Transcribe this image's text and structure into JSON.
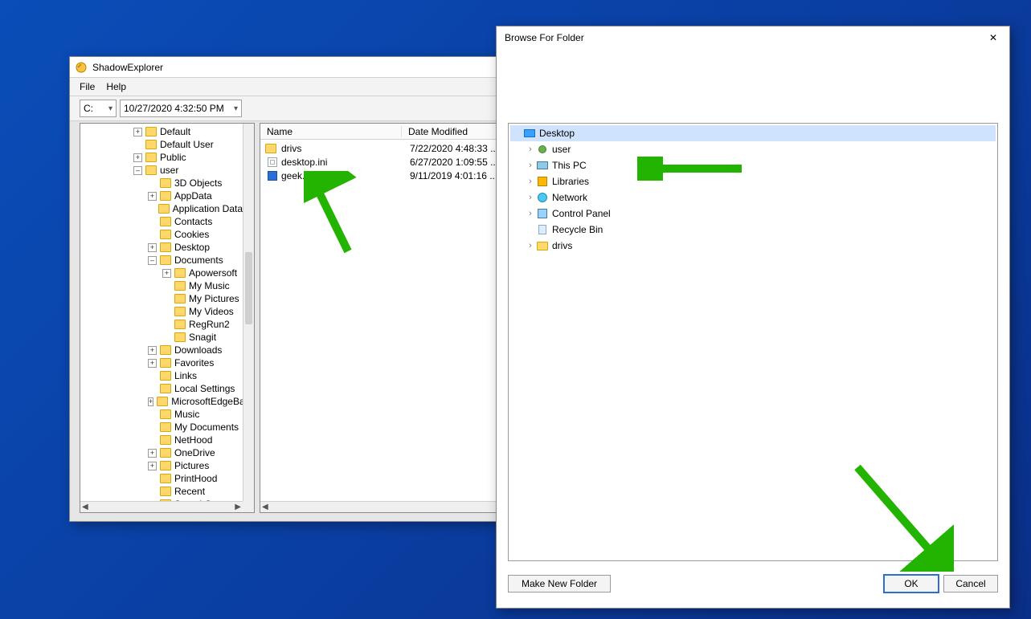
{
  "shadow": {
    "title": "ShadowExplorer",
    "menu": {
      "file": "File",
      "help": "Help"
    },
    "drive": "C:",
    "snapshot": "10/27/2020 4:32:50 PM",
    "tree": [
      {
        "level": 2,
        "exp": "+",
        "label": "Default"
      },
      {
        "level": 2,
        "exp": "",
        "label": "Default User"
      },
      {
        "level": 2,
        "exp": "+",
        "label": "Public"
      },
      {
        "level": 2,
        "exp": "-",
        "label": "user"
      },
      {
        "level": 3,
        "exp": "",
        "label": "3D Objects"
      },
      {
        "level": 3,
        "exp": "+",
        "label": "AppData"
      },
      {
        "level": 3,
        "exp": "",
        "label": "Application Data"
      },
      {
        "level": 3,
        "exp": "",
        "label": "Contacts"
      },
      {
        "level": 3,
        "exp": "",
        "label": "Cookies"
      },
      {
        "level": 3,
        "exp": "+",
        "label": "Desktop"
      },
      {
        "level": 3,
        "exp": "-",
        "label": "Documents"
      },
      {
        "level": 4,
        "exp": "+",
        "label": "Apowersoft"
      },
      {
        "level": 4,
        "exp": "",
        "label": "My Music"
      },
      {
        "level": 4,
        "exp": "",
        "label": "My Pictures"
      },
      {
        "level": 4,
        "exp": "",
        "label": "My Videos"
      },
      {
        "level": 4,
        "exp": "",
        "label": "RegRun2"
      },
      {
        "level": 4,
        "exp": "",
        "label": "Snagit"
      },
      {
        "level": 3,
        "exp": "+",
        "label": "Downloads"
      },
      {
        "level": 3,
        "exp": "+",
        "label": "Favorites"
      },
      {
        "level": 3,
        "exp": "",
        "label": "Links"
      },
      {
        "level": 3,
        "exp": "",
        "label": "Local Settings"
      },
      {
        "level": 3,
        "exp": "+",
        "label": "MicrosoftEdgeBacku"
      },
      {
        "level": 3,
        "exp": "",
        "label": "Music"
      },
      {
        "level": 3,
        "exp": "",
        "label": "My Documents"
      },
      {
        "level": 3,
        "exp": "",
        "label": "NetHood"
      },
      {
        "level": 3,
        "exp": "+",
        "label": "OneDrive"
      },
      {
        "level": 3,
        "exp": "+",
        "label": "Pictures"
      },
      {
        "level": 3,
        "exp": "",
        "label": "PrintHood"
      },
      {
        "level": 3,
        "exp": "",
        "label": "Recent"
      },
      {
        "level": 3,
        "exp": "",
        "label": "Saved Games"
      }
    ],
    "list": {
      "columns": {
        "name": "Name",
        "date": "Date Modified"
      },
      "rows": [
        {
          "icon": "folder",
          "name": "drivs",
          "date": "7/22/2020 4:48:33 ..."
        },
        {
          "icon": "ini",
          "name": "desktop.ini",
          "date": "6/27/2020 1:09:55 ..."
        },
        {
          "icon": "exe",
          "name": "geek.exe",
          "date": "9/11/2019 4:01:16 ..."
        }
      ]
    }
  },
  "browse": {
    "title": "Browse For Folder",
    "tree": [
      {
        "chev": "",
        "icon": "desktop",
        "label": "Desktop",
        "sel": true
      },
      {
        "chev": ">",
        "icon": "user",
        "label": "user"
      },
      {
        "chev": ">",
        "icon": "pc",
        "label": "This PC"
      },
      {
        "chev": ">",
        "icon": "lib",
        "label": "Libraries"
      },
      {
        "chev": ">",
        "icon": "net",
        "label": "Network"
      },
      {
        "chev": ">",
        "icon": "cp",
        "label": "Control Panel"
      },
      {
        "chev": "",
        "icon": "bin",
        "label": "Recycle Bin"
      },
      {
        "chev": ">",
        "icon": "folder",
        "label": "drivs"
      }
    ],
    "buttons": {
      "makeNew": "Make New Folder",
      "ok": "OK",
      "cancel": "Cancel"
    }
  }
}
